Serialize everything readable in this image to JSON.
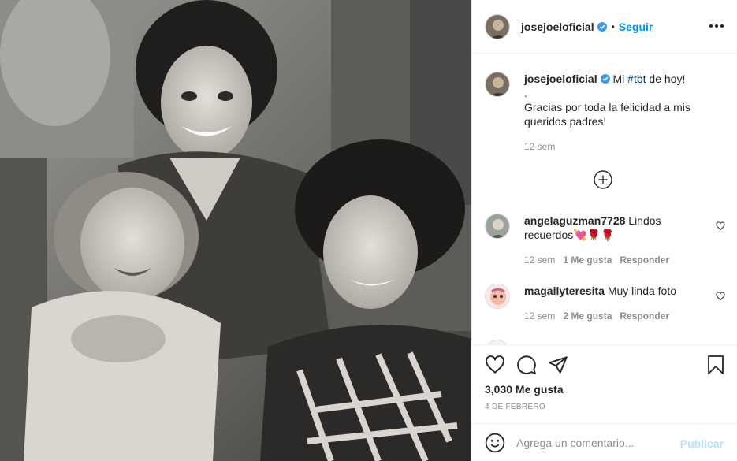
{
  "post": {
    "photo_description": "",
    "header": {
      "username": "josejoeloficial",
      "dot": "•",
      "follow_label": "Seguir"
    },
    "caption": {
      "username": "josejoeloficial",
      "text_before": "Mi ",
      "hashtag": "#tbt",
      "text_after": " de hoy!",
      "line2": ".",
      "line3": "Gracias por toda la felicidad a mis queridos padres!",
      "time": "12 sem"
    },
    "comments": [
      {
        "username": "angelaguzman7728",
        "text": "Lindos recuerdos💘🌹🌹",
        "time": "12 sem",
        "likes": "1 Me gusta",
        "reply": "Responder"
      },
      {
        "username": "magallyteresita",
        "text": "Muy linda foto",
        "time": "12 sem",
        "likes": "2 Me gusta",
        "reply": "Responder"
      }
    ],
    "likes_count": "3,030 Me gusta",
    "date": "4 DE FEBRERO",
    "comment_placeholder": "Agrega un comentario...",
    "publish_label": "Publicar"
  },
  "colors": {
    "accent": "#0095f6",
    "verified": "#3897f0",
    "publish_disabled": "#b2dffc",
    "muted": "#8e8e8e",
    "text": "#262626"
  },
  "icons": [
    "verified-badge-icon",
    "more-options-icon",
    "load-more-comments-icon",
    "comment-like-heart-icon",
    "like-heart-icon",
    "comment-bubble-icon",
    "share-plane-icon",
    "save-bookmark-icon",
    "emoji-smiley-icon"
  ]
}
